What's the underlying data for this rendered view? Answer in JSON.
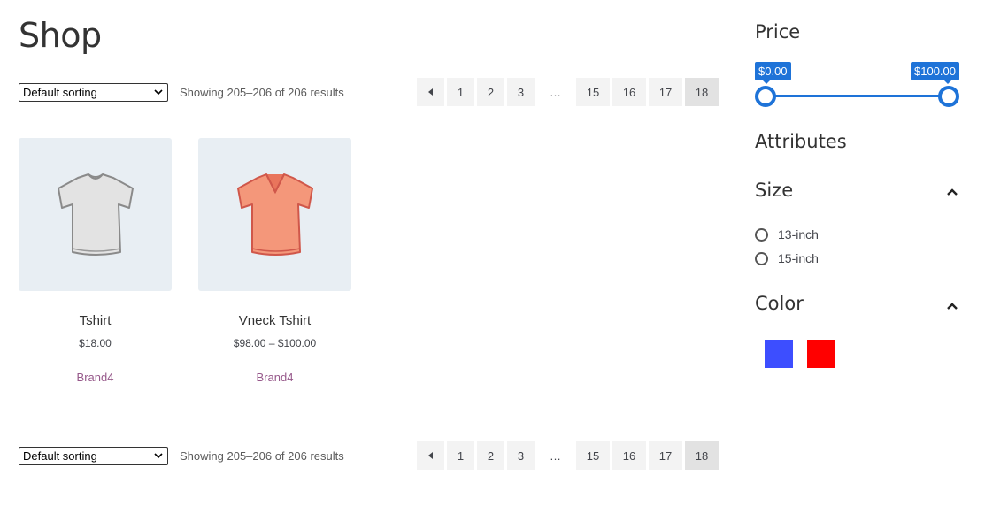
{
  "page": {
    "title": "Shop"
  },
  "toolbar": {
    "sorting_value": "Default sorting",
    "result_count": "Showing 205–206 of 206 results",
    "pagination": [
      "1",
      "2",
      "3",
      "…",
      "15",
      "16",
      "17",
      "18"
    ],
    "current_page": "18"
  },
  "products": [
    {
      "name": "Tshirt",
      "price": "$18.00",
      "brand": "Brand4",
      "image": "white-tshirt-icon"
    },
    {
      "name": "Vneck Tshirt",
      "price": "$98.00 – $100.00",
      "brand": "Brand4",
      "image": "pink-vneck-tshirt-icon"
    }
  ],
  "sidebar": {
    "price": {
      "title": "Price",
      "min_label": "$0.00",
      "max_label": "$100.00"
    },
    "attributes_title": "Attributes",
    "size": {
      "title": "Size",
      "options": [
        "13-inch",
        "15-inch"
      ]
    },
    "color": {
      "title": "Color",
      "swatches": [
        "#3d4eff",
        "#ff0000"
      ]
    }
  },
  "colors": {
    "accent": "#1e73d8",
    "brand_link": "#96588a",
    "pagination_bg": "#f3f3f3",
    "pagination_current_bg": "#e2e2e2"
  }
}
